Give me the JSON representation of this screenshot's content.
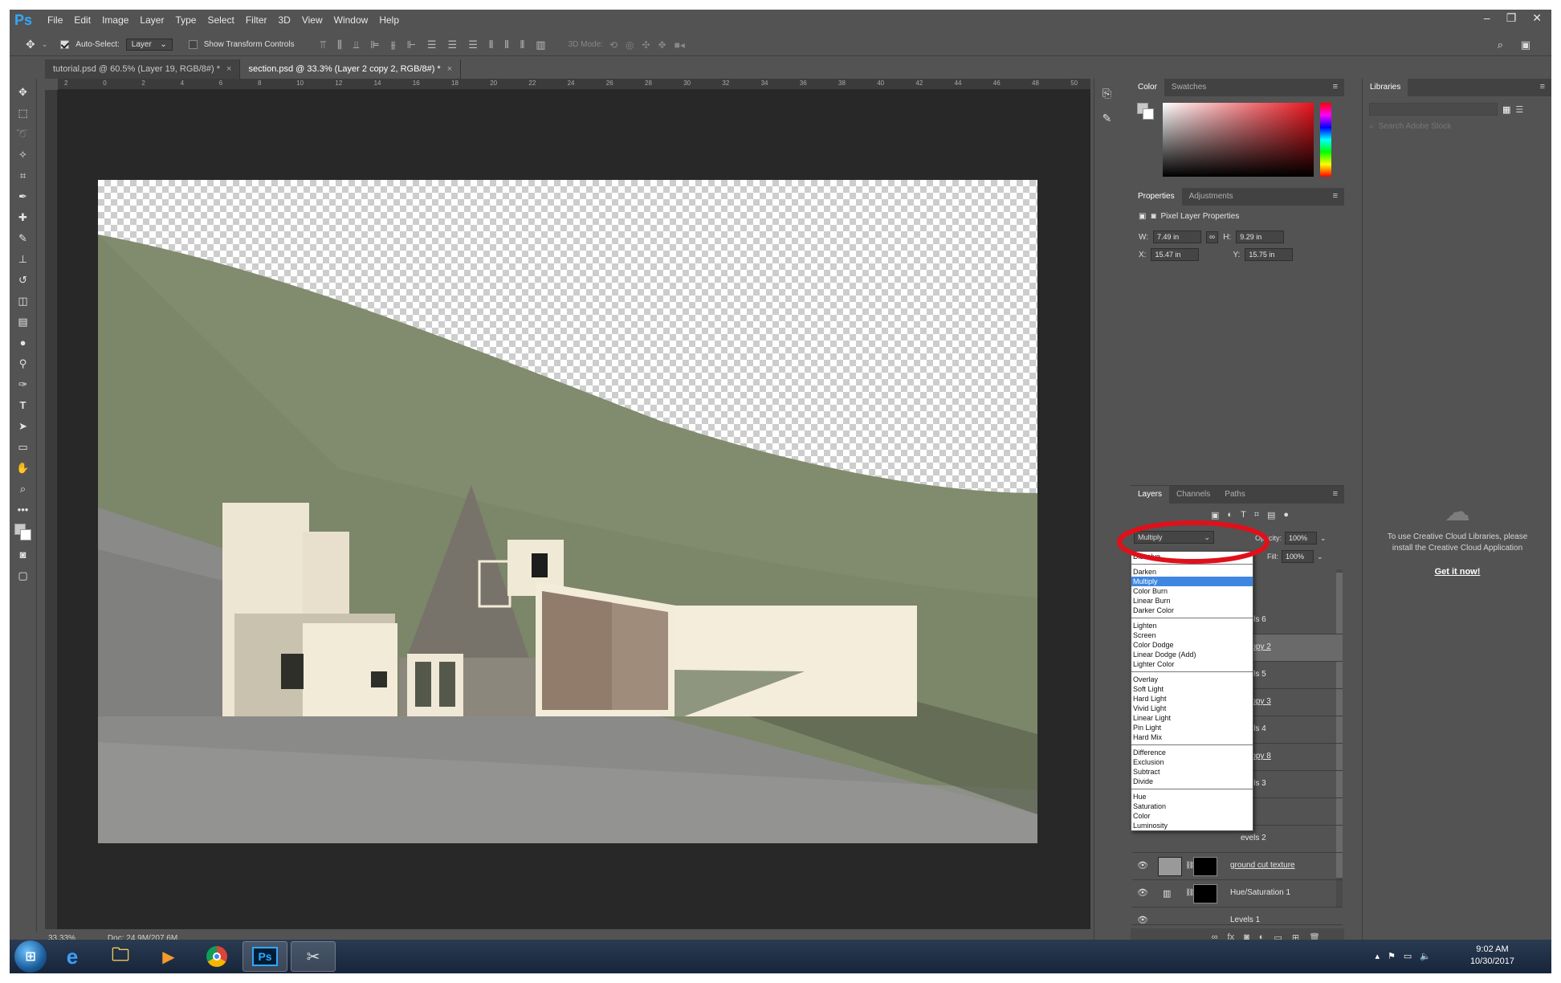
{
  "app": {
    "logo": "Ps",
    "menus": [
      "File",
      "Edit",
      "Image",
      "Layer",
      "Type",
      "Select",
      "Filter",
      "3D",
      "View",
      "Window",
      "Help"
    ],
    "window_controls": [
      "–",
      "❐",
      "✕"
    ]
  },
  "options_bar": {
    "auto_select_label": "Auto-Select:",
    "auto_select_target": "Layer",
    "show_transform_label": "Show Transform Controls",
    "mode_3d_label": "3D Mode:"
  },
  "tabs": [
    {
      "label": "tutorial.psd @ 60.5% (Layer 19, RGB/8#) *",
      "close": "×"
    },
    {
      "label": "section.psd @ 33.3% (Layer 2 copy 2, RGB/8#) *",
      "close": "×"
    }
  ],
  "rulers": {
    "top": [
      "2",
      "0",
      "2",
      "4",
      "6",
      "8",
      "10",
      "12",
      "14",
      "16",
      "18",
      "20",
      "22",
      "24",
      "26",
      "28",
      "30",
      "32",
      "34",
      "36",
      "38",
      "40",
      "42",
      "44",
      "46",
      "48",
      "50"
    ]
  },
  "status": {
    "zoom": "33.33%",
    "doc": "Doc: 24.9M/207.6M"
  },
  "color_panel": {
    "tabs": [
      "Color",
      "Swatches"
    ]
  },
  "properties_panel": {
    "tabs": [
      "Properties",
      "Adjustments"
    ],
    "title": "Pixel Layer Properties",
    "w_label": "W:",
    "w_value": "7.49 in",
    "h_label": "H:",
    "h_value": "9.29 in",
    "x_label": "X:",
    "x_value": "15.47 in",
    "y_label": "Y:",
    "y_value": "15.75 in"
  },
  "libraries_panel": {
    "title": "Libraries",
    "search_placeholder": "Search Adobe Stock",
    "message": "To use Creative Cloud Libraries, please install the Creative Cloud Application",
    "cta": "Get it now!"
  },
  "layers_panel": {
    "tabs": [
      "Layers",
      "Channels",
      "Paths"
    ],
    "blend_mode": "Multiply",
    "opacity_label": "Opacity:",
    "opacity_value": "100%",
    "fill_label": "Fill:",
    "fill_value": "100%",
    "layers": [
      {
        "name": "evels 6"
      },
      {
        "name": "2 copy 2"
      },
      {
        "name": "evels 5"
      },
      {
        "name": "2 copy 3"
      },
      {
        "name": "evels 4"
      },
      {
        "name": "2 copy 8"
      },
      {
        "name": "evels 3"
      },
      {
        "name": "1"
      },
      {
        "name": "evels 2"
      },
      {
        "name": "ground cut texture"
      },
      {
        "name": "Hue/Saturation 1"
      },
      {
        "name": "Levels 1"
      }
    ],
    "blend_groups": [
      [
        "Dissolve"
      ],
      [
        "Darken",
        "Multiply",
        "Color Burn",
        "Linear Burn",
        "Darker Color"
      ],
      [
        "Lighten",
        "Screen",
        "Color Dodge",
        "Linear Dodge (Add)",
        "Lighter Color"
      ],
      [
        "Overlay",
        "Soft Light",
        "Hard Light",
        "Vivid Light",
        "Linear Light",
        "Pin Light",
        "Hard Mix"
      ],
      [
        "Difference",
        "Exclusion",
        "Subtract",
        "Divide"
      ],
      [
        "Hue",
        "Saturation",
        "Color",
        "Luminosity"
      ]
    ]
  },
  "taskbar": {
    "time": "9:02 AM",
    "date": "10/30/2017",
    "ps_label": "Ps"
  },
  "colors": {
    "ui_bg": "#535353",
    "highlight": "#3f86e0",
    "annotation": "#e0101a",
    "hill": "#7c8669",
    "wall": "#ede6d3"
  }
}
